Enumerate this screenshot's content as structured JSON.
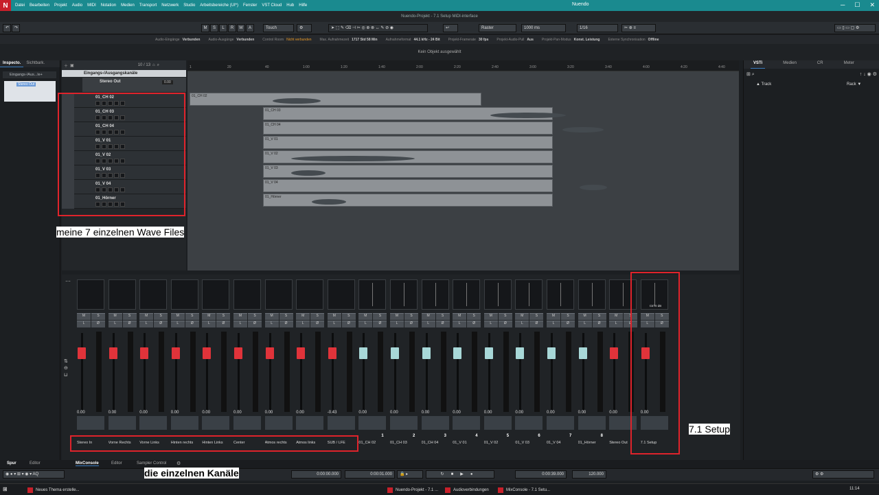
{
  "app": {
    "title": "Nuendo",
    "project_title": "Nuendo-Projekt - 7.1 Setup MiDI-interface",
    "menus": [
      "Datei",
      "Bearbeiten",
      "Projekt",
      "Audio",
      "MIDI",
      "Notation",
      "Medien",
      "Transport",
      "Netzwerk",
      "Studio",
      "Arbeitsbereiche (UI*)",
      "Fenster",
      "VST Cloud",
      "Hub",
      "Hilfe"
    ]
  },
  "toolbar": {
    "automation_mode": "Touch",
    "grid_label": "Raster",
    "nudge_value": "1000 ms",
    "quantize": "1/16",
    "msrwa": [
      "M",
      "S",
      "L",
      "R",
      "W",
      "A"
    ]
  },
  "status": [
    {
      "label": "Audio-Eingänge",
      "value": "Verbunden"
    },
    {
      "label": "Audio-Ausgänge",
      "value": "Verbunden"
    },
    {
      "label": "Control Room",
      "value": "Nicht verbunden"
    },
    {
      "label": "Max. Aufnahmezeit",
      "value": "1717 Std 58 Min"
    },
    {
      "label": "Aufnahmeformat",
      "value": "44.1 kHz - 24 Bit"
    },
    {
      "label": "Projekt-Framerate",
      "value": "30 fps"
    },
    {
      "label": "Projekt-Audio-Pull",
      "value": "Aus"
    },
    {
      "label": "Projekt-Pan-Modus",
      "value": "Konst. Leistung"
    },
    {
      "label": "Externe Synchronisation",
      "value": "Offline"
    }
  ],
  "info_line": "Kein Objekt ausgewählt",
  "inspector": {
    "tabs": [
      "Inspecto.",
      "Sichtbark."
    ],
    "folder": "Eingangs-/Aus...le+",
    "item": "Stereo Out"
  },
  "tracklist": {
    "counter": "10 / 13",
    "folder_name": "Eingangs-/Ausgangskanäle",
    "stereo_out": "Stereo Out",
    "stereo_out_val": "0.00",
    "tracks": [
      "01_CH 02",
      "01_CH 03",
      "01_CH 04",
      "01_V 01",
      "01_V 02",
      "01_V 03",
      "01_V 04",
      "01_Hörner"
    ]
  },
  "ruler": [
    "1",
    "20",
    "40",
    "1:00",
    "1:20",
    "1:40",
    "2:00",
    "2:20",
    "2:40",
    "3:00",
    "3:20",
    "3:40",
    "4:00",
    "4:20",
    "4:40"
  ],
  "clips": [
    "01_CH 02",
    "01_CH 03",
    "01_CH 04",
    "01_V 01",
    "01_V 02",
    "01_V 03",
    "01_V 04",
    "01_Hörner"
  ],
  "right_panel": {
    "tabs": [
      "VSTi",
      "Medien",
      "CR",
      "Meter"
    ],
    "track_label": "Track",
    "rack_label": "Rack"
  },
  "mixer": {
    "strips": [
      {
        "name": "Stereo In",
        "value": "0.00",
        "type": "input"
      },
      {
        "name": "Vorne Rechts",
        "value": "0.00",
        "type": "input"
      },
      {
        "name": "Vorne Links",
        "value": "0.00",
        "type": "input"
      },
      {
        "name": "Hinten rechts",
        "value": "0.00",
        "type": "input"
      },
      {
        "name": "Hinten Links",
        "value": "0.00",
        "type": "input"
      },
      {
        "name": "Center",
        "value": "0.00",
        "type": "input"
      },
      {
        "name": "Atmos rechts",
        "value": "0.00",
        "type": "input"
      },
      {
        "name": "Atmos links",
        "value": "0.00",
        "type": "input"
      },
      {
        "name": "SUB / LFE",
        "value": "-0.43",
        "type": "input"
      },
      {
        "name": "01_CH 02",
        "value": "0.00",
        "type": "audio",
        "num": "1"
      },
      {
        "name": "01_CH 03",
        "value": "0.00",
        "type": "audio",
        "num": "2"
      },
      {
        "name": "01_CH 04",
        "value": "0.00",
        "type": "audio",
        "num": "3"
      },
      {
        "name": "01_V 01",
        "value": "0.00",
        "type": "audio",
        "num": "4"
      },
      {
        "name": "01_V 02",
        "value": "0.00",
        "type": "audio",
        "num": "5"
      },
      {
        "name": "01_V 03",
        "value": "0.00",
        "type": "audio",
        "num": "6"
      },
      {
        "name": "01_V 04",
        "value": "0.00",
        "type": "audio",
        "num": "7"
      },
      {
        "name": "01_Hörner",
        "value": "0.00",
        "type": "audio",
        "num": "8"
      },
      {
        "name": "Stereo Out",
        "value": "0.00",
        "type": "output"
      },
      {
        "name": "7.1 Setup",
        "value": "0.00",
        "type": "output",
        "panner": "Ctrl 0 dB"
      }
    ]
  },
  "bottom_tabs": {
    "left": [
      "Spur",
      "Editor"
    ],
    "main": [
      "MixConsole",
      "Editor",
      "Sampler Control"
    ]
  },
  "transport": {
    "position": "0:00:00.000",
    "cycle": "0:00:01.000",
    "time": "0:00:39.000",
    "tempo": "120.000"
  },
  "taskbar": [
    {
      "label": "Neues Thema erstelle..."
    },
    {
      "label": "Nuendo-Projekt - 7.1 ..."
    },
    {
      "label": "Audioverbindungen"
    },
    {
      "label": "MixConsole - 7.1 Setu..."
    }
  ],
  "clock": "11:14",
  "annotations": {
    "wave_files": "meine 7 einzelnen Wave Files",
    "setup": "7.1 Setup",
    "channels": "die einzelnen  Kanäle"
  },
  "colors": {
    "accent": "#1a8a8f",
    "fader_red": "#e0333a",
    "fader_cyan": "#a8d8d8",
    "annotation_red": "#e0232b"
  }
}
